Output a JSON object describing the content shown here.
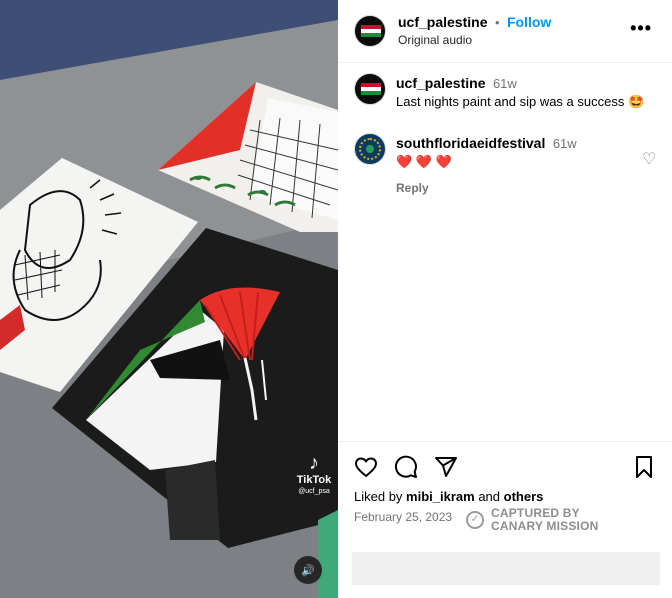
{
  "post": {
    "username": "ucf_palestine",
    "separator": "•",
    "follow_label": "Follow",
    "audio": "Original audio",
    "more_label": "•••"
  },
  "media": {
    "tiktok_label": "TikTok",
    "tiktok_handle": "@ucf_psa",
    "tiktok_glyph": "♪",
    "sound_icon": "speaker-icon",
    "sound_glyph": "🔊"
  },
  "comments": [
    {
      "username": "ucf_palestine",
      "age": "61w",
      "text": "Last nights paint and sip was a success 🤩"
    },
    {
      "username": "southfloridaeidfestival",
      "age": "61w",
      "text": "❤️ ❤️ ❤️",
      "reply_label": "Reply",
      "like_glyph": "♡"
    }
  ],
  "actions": {
    "icons": [
      "heart-icon",
      "comment-icon",
      "share-icon",
      "bookmark-icon"
    ]
  },
  "likes": {
    "prefix": "Liked by ",
    "user": "mibi_ikram",
    "middle": " and ",
    "others": "others"
  },
  "date": "February 25, 2023",
  "watermark": {
    "line1": "CAPTURED BY",
    "line2": "CANARY MISSION",
    "icon_glyph": "✓"
  },
  "colors": {
    "follow": "#0095f6",
    "flag_red": "#e8302b",
    "flag_green": "#2f8a32",
    "flag_black": "#1c1c1c"
  }
}
